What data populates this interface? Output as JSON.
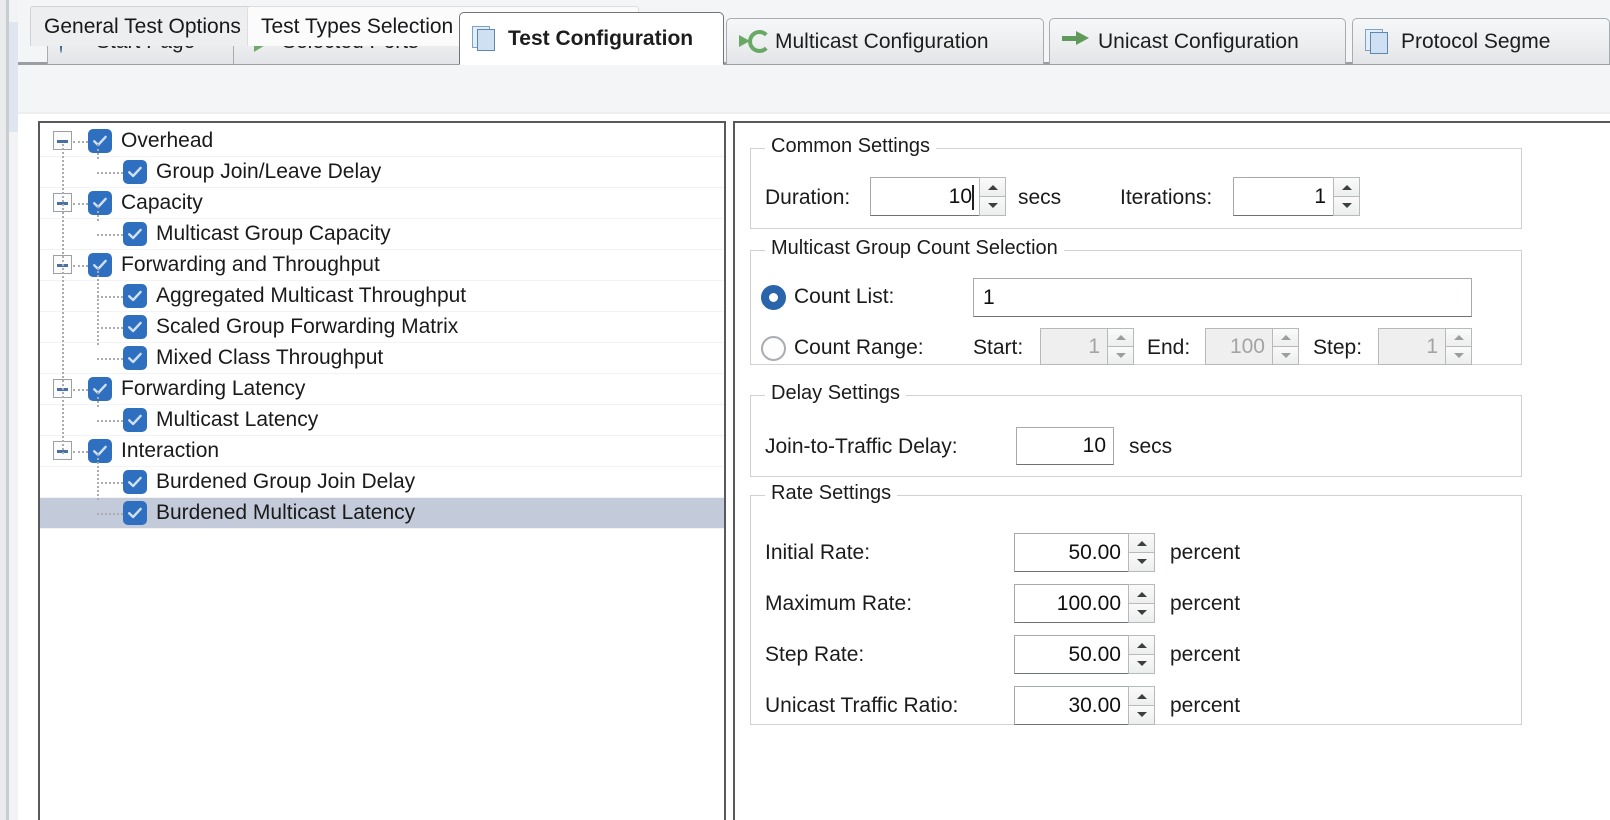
{
  "tabs": [
    {
      "label": "Start Page",
      "icon": "info-icon",
      "active": false
    },
    {
      "label": "Selected Ports",
      "icon": "ports-icon",
      "active": false
    },
    {
      "label": "Test Configuration",
      "icon": "documents-icon",
      "active": true
    },
    {
      "label": "Multicast Configuration",
      "icon": "multicast-icon",
      "active": false
    },
    {
      "label": "Unicast Configuration",
      "icon": "arrow-right-icon",
      "active": false
    },
    {
      "label": "Protocol Segme",
      "icon": "documents-icon",
      "active": false
    }
  ],
  "subtabs": [
    {
      "label": "General Test Options",
      "active": false
    },
    {
      "label": "Test Types Selection and Configuration",
      "active": true
    }
  ],
  "tree": [
    {
      "label": "Overhead",
      "level": 0,
      "checked": true,
      "expander": "minus",
      "selected": false
    },
    {
      "label": "Group Join/Leave Delay",
      "level": 1,
      "checked": true,
      "expander": "none",
      "selected": false
    },
    {
      "label": "Capacity",
      "level": 0,
      "checked": true,
      "expander": "minus",
      "selected": false
    },
    {
      "label": "Multicast Group Capacity",
      "level": 1,
      "checked": true,
      "expander": "none",
      "selected": false
    },
    {
      "label": "Forwarding and Throughput",
      "level": 0,
      "checked": true,
      "expander": "minus",
      "selected": false
    },
    {
      "label": "Aggregated Multicast Throughput",
      "level": 1,
      "checked": true,
      "expander": "none",
      "selected": false
    },
    {
      "label": "Scaled Group Forwarding Matrix",
      "level": 1,
      "checked": true,
      "expander": "none",
      "selected": false
    },
    {
      "label": "Mixed Class Throughput",
      "level": 1,
      "checked": true,
      "expander": "none",
      "selected": false
    },
    {
      "label": "Forwarding Latency",
      "level": 0,
      "checked": true,
      "expander": "minus",
      "selected": false
    },
    {
      "label": "Multicast Latency",
      "level": 1,
      "checked": true,
      "expander": "none",
      "selected": false
    },
    {
      "label": "Interaction",
      "level": 0,
      "checked": true,
      "expander": "minus",
      "selected": false
    },
    {
      "label": "Burdened Group Join Delay",
      "level": 1,
      "checked": true,
      "expander": "none",
      "selected": false
    },
    {
      "label": "Burdened Multicast Latency",
      "level": 1,
      "checked": true,
      "expander": "none",
      "selected": true
    }
  ],
  "common_settings": {
    "title": "Common Settings",
    "duration_label": "Duration:",
    "duration_value": "10",
    "duration_units": "secs",
    "iterations_label": "Iterations:",
    "iterations_value": "1"
  },
  "group_count": {
    "title": "Multicast Group Count Selection",
    "count_list_label": "Count List:",
    "count_list_value": "1",
    "count_list_selected": true,
    "count_range_label": "Count Range:",
    "count_range_selected": false,
    "start_label": "Start:",
    "start_value": "1",
    "end_label": "End:",
    "end_value": "100",
    "step_label": "Step:",
    "step_value": "1"
  },
  "delay_settings": {
    "title": "Delay Settings",
    "join_delay_label": "Join-to-Traffic Delay:",
    "join_delay_value": "10",
    "join_delay_units": "secs"
  },
  "rate_settings": {
    "title": "Rate Settings",
    "rows": [
      {
        "label": "Initial Rate:",
        "value": "50.00",
        "units": "percent"
      },
      {
        "label": "Maximum Rate:",
        "value": "100.00",
        "units": "percent"
      },
      {
        "label": "Step Rate:",
        "value": "50.00",
        "units": "percent"
      },
      {
        "label": "Unicast Traffic Ratio:",
        "value": "30.00",
        "units": "percent"
      }
    ]
  },
  "colors": {
    "checkbox_blue": "#2f6fc0",
    "radio_blue": "#2a64ab",
    "selection": "#c3cbdb",
    "panel_border": "#59595b"
  }
}
